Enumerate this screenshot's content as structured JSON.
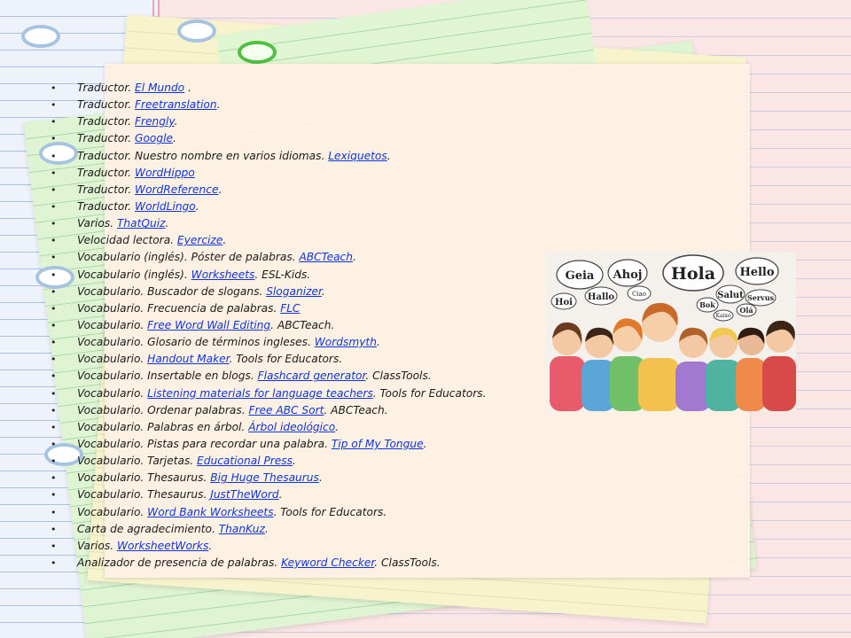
{
  "items": [
    {
      "prefix": "Traductor. ",
      "link": "El Mundo",
      "suffix": " ."
    },
    {
      "prefix": "Traductor. ",
      "link": "Freetranslation",
      "suffix": "."
    },
    {
      "prefix": "Traductor. ",
      "link": "Frengly",
      "suffix": "."
    },
    {
      "prefix": "Traductor. ",
      "link": "Google",
      "suffix": "."
    },
    {
      "prefix": "Traductor. Nuestro nombre en varios idiomas. ",
      "link": "Lexiquetos",
      "suffix": "."
    },
    {
      "prefix": "Traductor. ",
      "link": "WordHippo",
      "suffix": ""
    },
    {
      "prefix": "Traductor. ",
      "link": "WordReference",
      "suffix": "."
    },
    {
      "prefix": "Traductor. ",
      "link": "WorldLingo",
      "suffix": "."
    },
    {
      "prefix": "Varios. ",
      "link": "ThatQuiz",
      "suffix": "."
    },
    {
      "prefix": "Velocidad lectora. ",
      "link": "Eyercize",
      "suffix": "."
    },
    {
      "prefix": "Vocabulario (inglés). Póster de palabras. ",
      "link": "ABCTeach",
      "suffix": "."
    },
    {
      "prefix": "Vocabulario (inglés). ",
      "link": "Worksheets",
      "suffix": ". ESL-Kids."
    },
    {
      "prefix": "Vocabulario. Buscador de slogans. ",
      "link": "Sloganizer",
      "suffix": "."
    },
    {
      "prefix": "Vocabulario. Frecuencia de palabras. ",
      "link": "FLC",
      "suffix": ""
    },
    {
      "prefix": "Vocabulario. ",
      "link": "Free Word Wall Editing",
      "suffix": ". ABCTeach."
    },
    {
      "prefix": "Vocabulario. Glosario de términos ingleses. ",
      "link": "Wordsmyth",
      "suffix": "."
    },
    {
      "prefix": "Vocabulario. ",
      "link": "Handout Maker",
      "suffix": ". Tools for Educators."
    },
    {
      "prefix": "Vocabulario. Insertable en blogs. ",
      "link": "Flashcard generator",
      "suffix": ". ClassTools."
    },
    {
      "prefix": "Vocabulario. ",
      "link": "Listening materials for language teachers",
      "suffix": ". Tools for Educators."
    },
    {
      "prefix": "Vocabulario. Ordenar palabras. ",
      "link": "Free ABC Sort",
      "suffix": ". ABCTeach."
    },
    {
      "prefix": "Vocabulario. Palabras en árbol. ",
      "link": "Árbol ideológico",
      "suffix": "."
    },
    {
      "prefix": "Vocabulario. Pistas para recordar una palabra. ",
      "link": "Tip of My Tongue",
      "suffix": "."
    },
    {
      "prefix": "Vocabulario. Tarjetas. ",
      "link": "Educational Press",
      "suffix": "."
    },
    {
      "prefix": "Vocabulario. Thesaurus. ",
      "link": "Big Huge Thesaurus",
      "suffix": "."
    },
    {
      "prefix": "Vocabulario. Thesaurus. ",
      "link": "JustTheWord",
      "suffix": "."
    },
    {
      "prefix": "Vocabulario. ",
      "link": "Word Bank Worksheets",
      "suffix": ". Tools for Educators."
    },
    {
      "prefix": "Carta de agradecimiento. ",
      "link": "ThanKuz",
      "suffix": "."
    },
    {
      "prefix": "Varios. ",
      "link": "WorksheetWorks",
      "suffix": "."
    },
    {
      "prefix": "Analizador de presencia de palabras. ",
      "link": "Keyword Checker",
      "suffix": ". ClassTools."
    }
  ],
  "colors": {
    "link": "#1034d8",
    "text": "#1a1a1a",
    "sheet": "#fdf0e4"
  },
  "illustration": {
    "icon": "multilingual-greetings-illustration",
    "greetings": [
      "Geia",
      "Ahoj",
      "Hola",
      "Hello",
      "Hallo",
      "Ciao",
      "Hoi",
      "Salut",
      "Servus",
      "Bok",
      "Olá",
      "Kaixo"
    ]
  }
}
